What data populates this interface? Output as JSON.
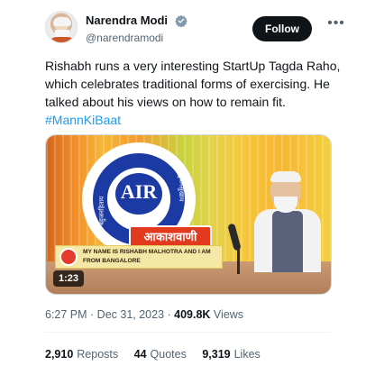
{
  "author": {
    "display_name": "Narendra Modi",
    "handle": "@narendramodi",
    "verified": true
  },
  "header": {
    "follow_label": "Follow",
    "more_icon": "more-horizontal-icon"
  },
  "tweet": {
    "text": "Rishabh runs a very interesting StartUp Tagda Raho, which celebrates traditional forms of exercising. He talked about his views on how to remain fit. ",
    "hashtag": "#MannKiBaat"
  },
  "media": {
    "logo_text": "AIR",
    "logo_ribbon": "आकाशवाणी",
    "logo_side_left": "बहुजनहिताय",
    "logo_side_right": "बहुजनसुखाय",
    "banner_text": "MY NAME IS RISHABH MALHOTRA AND I AM FROM BANGALORE",
    "duration": "1:23"
  },
  "meta": {
    "time": "6:27 PM",
    "separator": " · ",
    "date": "Dec 31, 2023",
    "views_count": "409.8K",
    "views_label": " Views"
  },
  "stats": {
    "reposts_count": "2,910",
    "reposts_label": "Reposts",
    "quotes_count": "44",
    "quotes_label": "Quotes",
    "likes_count": "9,319",
    "likes_label": "Likes"
  },
  "colors": {
    "link": "#1d9bf0",
    "text_primary": "#0f1419",
    "text_secondary": "#536471",
    "follow_bg": "#0f1419",
    "logo_blue": "#1c3aa4",
    "ribbon_red": "#e23a1e"
  }
}
